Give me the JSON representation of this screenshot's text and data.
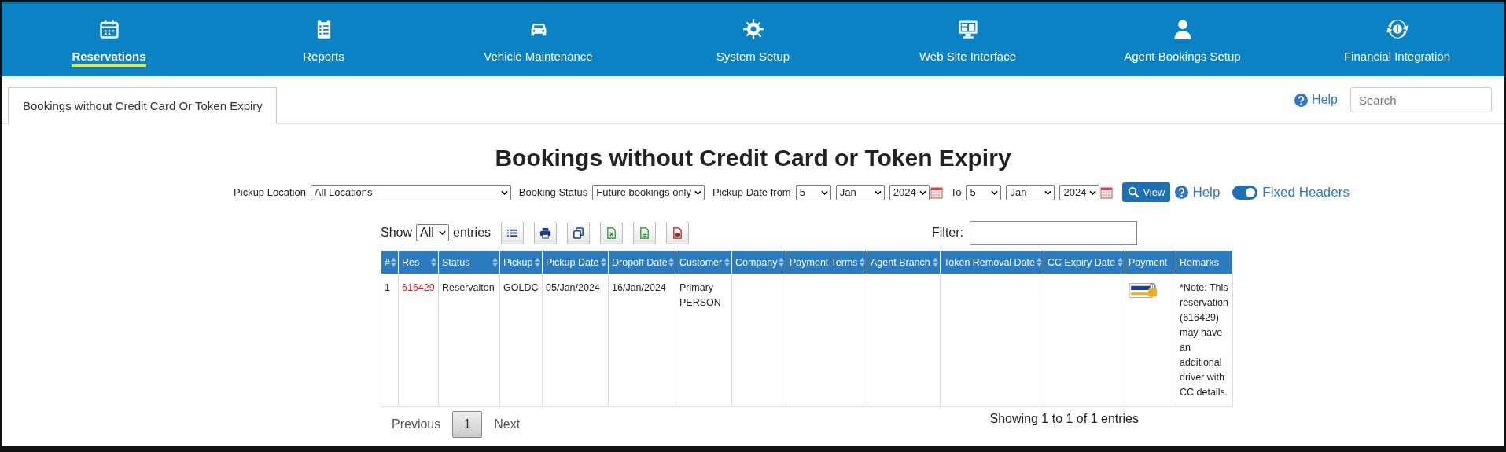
{
  "nav": [
    {
      "label": "Reservations",
      "selected": true
    },
    {
      "label": "Reports",
      "selected": false
    },
    {
      "label": "Vehicle Maintenance",
      "selected": false
    },
    {
      "label": "System Setup",
      "selected": false
    },
    {
      "label": "Web Site Interface",
      "selected": false
    },
    {
      "label": "Agent Bookings Setup",
      "selected": false
    },
    {
      "label": "Financial Integration",
      "selected": false
    }
  ],
  "tab": {
    "label": "Bookings without Credit Card Or Token Expiry",
    "selected": true
  },
  "help": "Help",
  "search": {
    "placeholder": "Search"
  },
  "title": "Bookings without Credit Card or Token Expiry",
  "filters": {
    "pickup_location_label": "Pickup Location",
    "pickup_location": "All Locations",
    "booking_status_label": "Booking Status",
    "booking_status": "Future bookings only",
    "date_from_label": "Pickup Date from",
    "from_day": "5",
    "from_month": "Jan",
    "from_year": "2024",
    "to_label": "To",
    "to_day": "5",
    "to_month": "Jan",
    "to_year": "2024",
    "view": "View",
    "help": "Help",
    "fixed_headers": {
      "label": "Fixed Headers",
      "on": true
    }
  },
  "table_controls": {
    "show": "Show",
    "entries_value": "All",
    "entries": "entries",
    "filter_label": "Filter:"
  },
  "columns": [
    {
      "label": "#",
      "sortable": true
    },
    {
      "label": "Res",
      "sortable": true
    },
    {
      "label": "Status",
      "sortable": true
    },
    {
      "label": "Pickup",
      "sortable": true
    },
    {
      "label": "Pickup Date",
      "sortable": true
    },
    {
      "label": "Dropoff Date",
      "sortable": true
    },
    {
      "label": "Customer",
      "sortable": true
    },
    {
      "label": "Company",
      "sortable": true
    },
    {
      "label": "Payment Terms",
      "sortable": true
    },
    {
      "label": "Agent Branch",
      "sortable": true
    },
    {
      "label": "Token Removal Date",
      "sortable": true
    },
    {
      "label": "CC Expiry Date",
      "sortable": true
    },
    {
      "label": "Payment",
      "sortable": false
    },
    {
      "label": "Remarks",
      "sortable": false
    }
  ],
  "rows": [
    {
      "cells": [
        "1",
        "616429",
        "Reservaiton",
        "GOLDC",
        "05/Jan/2024",
        "16/Jan/2024",
        "Primary PERSON",
        "",
        "",
        "",
        "",
        "",
        "",
        "*Note: This reservation (616429) may have an additional driver with CC details."
      ]
    }
  ],
  "pagination": {
    "previous": "Previous",
    "pages": [
      {
        "label": "1",
        "selected": true
      }
    ],
    "next": "Next"
  },
  "info": "Showing 1 to 1 of 1 entries"
}
